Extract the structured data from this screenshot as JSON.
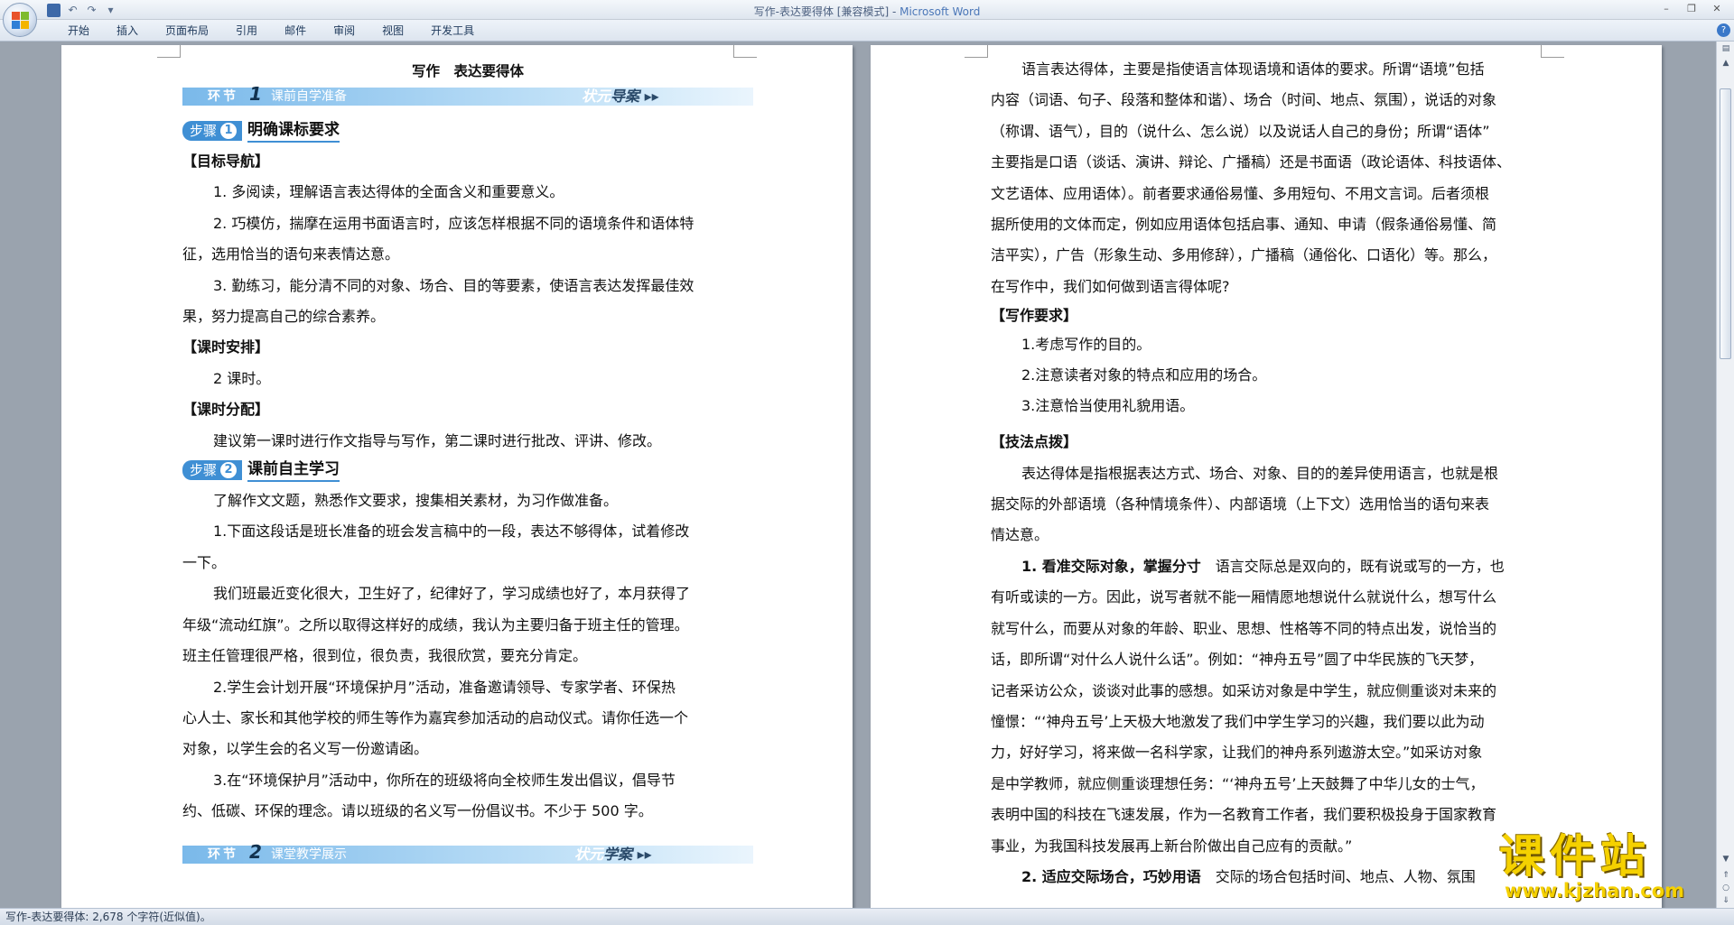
{
  "window": {
    "title": "写作-表达要得体 [兼容模式] - ",
    "app_name": "Microsoft Word",
    "minimize": "–",
    "restore": "❐",
    "close": "✕"
  },
  "qat": {
    "undo": "↶",
    "redo": "↷",
    "more": "▾"
  },
  "ribbon": {
    "tabs": [
      "开始",
      "插入",
      "页面布局",
      "引用",
      "邮件",
      "审阅",
      "视图",
      "开发工具"
    ],
    "help": "?"
  },
  "left_page": {
    "title": "写作　表达要得体",
    "bar1": {
      "label": "环节",
      "number": "1",
      "sub": "课前自学准备",
      "right_small": "状元",
      "right_big": "导案 ▸▸"
    },
    "step1": {
      "chip": "步骤",
      "num": "1",
      "title": "明确课标要求"
    },
    "h_goal": "【目标导航】",
    "goal_1": "1. 多阅读，理解语言表达得体的全面含义和重要意义。",
    "goal_2a": "2. 巧模仿，揣摩在运用书面语言时，应该怎样根据不同的语境条件和语体特",
    "goal_2b": "征，选用恰当的语句来表情达意。",
    "goal_3a": "3. 勤练习，能分清不同的对象、场合、目的等要素，使语言表达发挥最佳效",
    "goal_3b": "果，努力提高自己的综合素养。",
    "h_hours": "【课时安排】",
    "hours": "2 课时。",
    "h_alloc": "【课时分配】",
    "alloc": "建议第一课时进行作文指导与写作，第二课时进行批改、评讲、修改。",
    "step2": {
      "chip": "步骤",
      "num": "2",
      "title": "课前自主学习"
    },
    "intro": "了解作文文题，熟悉作文要求，搜集相关素材，为习作做准备。",
    "q1a": "1.下面这段话是班长准备的班会发言稿中的一段，表达不够得体，试着修改",
    "q1b": "一下。",
    "q1_text_a": "我们班最近变化很大，卫生好了，纪律好了，学习成绩也好了，本月获得了",
    "q1_text_b": "年级“流动红旗”。之所以取得这样好的成绩，我认为主要归备于班主任的管理。",
    "q1_text_c": "班主任管理很严格，很到位，很负责，我很欣赏，要充分肯定。",
    "q2a": "2.学生会计划开展“环境保护月”活动，准备邀请领导、专家学者、环保热",
    "q2b": "心人士、家长和其他学校的师生等作为嘉宾参加活动的启动仪式。请你任选一个",
    "q2c": "对象，以学生会的名义写一份邀请函。",
    "q3a": "3.在“环境保护月”活动中，你所在的班级将向全校师生发出倡议，倡导节",
    "q3b": "约、低碳、环保的理念。请以班级的名义写一份倡议书。不少于 500 字。",
    "bar2": {
      "label": "环节",
      "number": "2",
      "sub": "课堂教学展示",
      "right_small": "状元",
      "right_big": "学案 ▸▸"
    }
  },
  "right_page": {
    "p1": "语言表达得体，主要是指使语言体现语境和语体的要求。所谓“语境”包括",
    "p2": "内容（词语、句子、段落和整体和谐）、场合（时间、地点、氛围），说话的对象",
    "p3": "（称谓、语气），目的（说什么、怎么说）以及说话人自己的身份；所谓“语体”",
    "p4": "主要指是口语（谈话、演讲、辩论、广播稿）还是书面语（政论语体、科技语体、",
    "p5": "文艺语体、应用语体）。前者要求通俗易懂、多用短句、不用文言词。后者须根",
    "p6": "据所使用的文体而定，例如应用语体包括启事、通知、申请（假条通俗易懂、简",
    "p7": "洁平实），广告（形象生动、多用修辞），广播稿（通俗化、口语化）等。那么，",
    "p8": "在写作中，我们如何做到语言得体呢?",
    "h_req": "【写作要求】",
    "req1": "1.考虑写作的目的。",
    "req2": "2.注意读者对象的特点和应用的场合。",
    "req3": "3.注意恰当使用礼貌用语。",
    "h_tips": "【技法点拨】",
    "t1": "表达得体是指根据表达方式、场合、对象、目的的差异使用语言，也就是根",
    "t2": "据交际的外部语境（各种情境条件）、内部语境（上下文）选用恰当的语句来表",
    "t3": "情达意。",
    "s1_head": "1. 看准交际对象，掌握分寸",
    "s1_a": "　语言交际总是双向的，既有说或写的一方，也",
    "s1_b": "有听或读的一方。因此，说写者就不能一厢情愿地想说什么就说什么，想写什么",
    "s1_c": "就写什么，而要从对象的年龄、职业、思想、性格等不同的特点出发，说恰当的",
    "s1_d": "话，即所谓“对什么人说什么话”。例如：“神舟五号”圆了中华民族的飞天梦，",
    "s1_e": "记者采访公众，谈谈对此事的感想。如采访对象是中学生，就应侧重谈对未来的",
    "s1_f": "憧憬：“‘神舟五号’上天极大地激发了我们中学生学习的兴趣，我们要以此为动",
    "s1_g": "力，好好学习，将来做一名科学家，让我们的神舟系列遨游太空。”如采访对象",
    "s1_h": "是中学教师，就应侧重谈理想任务：“‘神舟五号’上天鼓舞了中华儿女的士气，",
    "s1_i": "表明中国的科技在飞速发展，作为一名教育工作者，我们要积极投身于国家教育",
    "s1_j": "事业，为我国科技发展再上新台阶做出自己应有的贡献。”",
    "s2_head": "2. 适应交际场合，巧妙用语",
    "s2_a": "　交际的场合包括时间、地点、人物、氛围"
  },
  "status": {
    "text": "写作-表达要得体: 2,678 个字符(近似值)。"
  },
  "watermark": {
    "line1": "课件站",
    "line2": "www.kjzhan.com"
  },
  "colors": {
    "accent": "#3f8fd4",
    "bar_start": "#7ab9ea",
    "watermark": "#f5d100"
  }
}
